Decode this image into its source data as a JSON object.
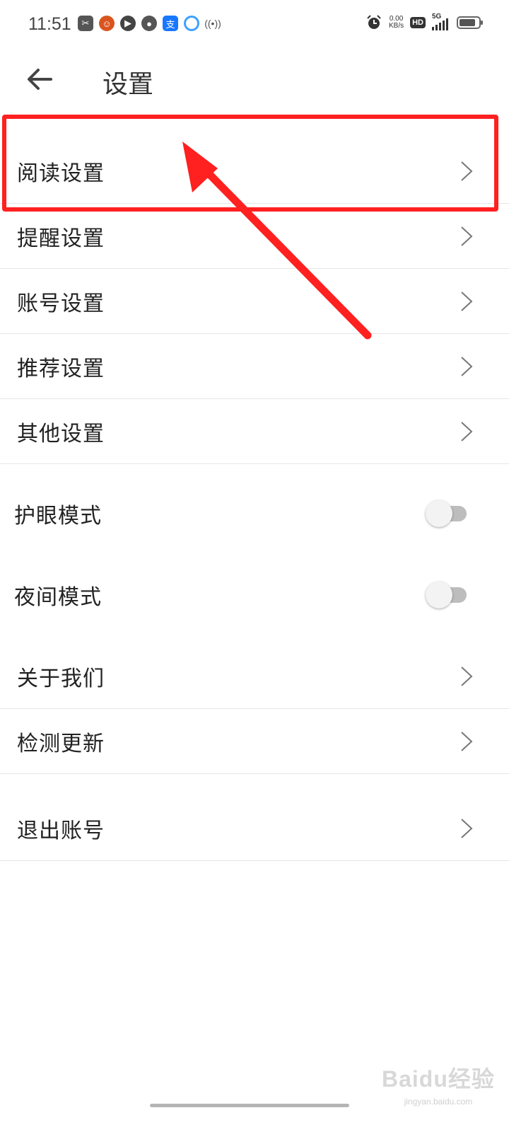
{
  "status_bar": {
    "time": "11:51",
    "net_speed_value": "0.00",
    "net_speed_unit": "KB/s",
    "hd_badge": "HD",
    "network_type": "5G",
    "left_icons": [
      "scissors-app-icon",
      "baby-app-icon",
      "play-app-icon",
      "chat-app-icon",
      "text-app-icon",
      "browser-app-icon",
      "hotspot-icon"
    ],
    "right_icons": [
      "alarm-icon",
      "signal-icon",
      "battery-icon"
    ]
  },
  "header": {
    "title": "设置",
    "back_icon": "arrow-left-icon"
  },
  "settings": {
    "group1": [
      {
        "label": "阅读设置"
      },
      {
        "label": "提醒设置"
      },
      {
        "label": "账号设置"
      },
      {
        "label": "推荐设置"
      },
      {
        "label": "其他设置"
      }
    ],
    "toggles": [
      {
        "label": "护眼模式",
        "enabled": false
      },
      {
        "label": "夜间模式",
        "enabled": false
      }
    ],
    "group2": [
      {
        "label": "关于我们"
      },
      {
        "label": "检测更新"
      }
    ],
    "logout": {
      "label": "退出账号"
    }
  },
  "annotation": {
    "color": "#ff2020"
  },
  "watermark": {
    "main": "Baidu经验",
    "sub": "jingyan.baidu.com"
  }
}
